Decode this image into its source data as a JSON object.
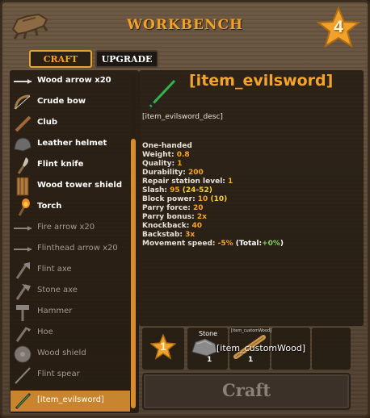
{
  "header": {
    "title": "WORKBENCH",
    "station_level": "4",
    "logo_icon": "workbench-icon"
  },
  "tabs": [
    {
      "label": "CRAFT",
      "active": true
    },
    {
      "label": "UPGRADE",
      "active": false
    }
  ],
  "recipes": [
    {
      "name": "Wood arrow x20",
      "icon": "wood-arrow-icon",
      "state": "available"
    },
    {
      "name": "Crude bow",
      "icon": "crude-bow-icon",
      "state": "available"
    },
    {
      "name": "Club",
      "icon": "club-icon",
      "state": "available"
    },
    {
      "name": "Leather helmet",
      "icon": "leather-helmet-icon",
      "state": "available"
    },
    {
      "name": "Flint knife",
      "icon": "flint-knife-icon",
      "state": "available"
    },
    {
      "name": "Wood tower shield",
      "icon": "wood-tower-shield-icon",
      "state": "available"
    },
    {
      "name": "Torch",
      "icon": "torch-icon",
      "state": "available"
    },
    {
      "name": "Fire arrow x20",
      "icon": "fire-arrow-icon",
      "state": "disabled"
    },
    {
      "name": "Flinthead arrow x20",
      "icon": "flinthead-arrow-icon",
      "state": "disabled"
    },
    {
      "name": "Flint axe",
      "icon": "flint-axe-icon",
      "state": "disabled"
    },
    {
      "name": "Stone axe",
      "icon": "stone-axe-icon",
      "state": "disabled"
    },
    {
      "name": "Hammer",
      "icon": "hammer-icon",
      "state": "disabled"
    },
    {
      "name": "Hoe",
      "icon": "hoe-icon",
      "state": "disabled"
    },
    {
      "name": "Wood shield",
      "icon": "wood-shield-icon",
      "state": "disabled"
    },
    {
      "name": "Flint spear",
      "icon": "flint-spear-icon",
      "state": "disabled"
    },
    {
      "name": "[item_evilsword]",
      "icon": "evil-sword-icon",
      "state": "selected"
    }
  ],
  "detail": {
    "name": "[item_evilsword]",
    "description": "[item_evilsword_desc]",
    "stats": [
      {
        "label": "One-handed",
        "value": "",
        "extra": ""
      },
      {
        "label": "Weight: ",
        "value": "0.8",
        "extra": ""
      },
      {
        "label": "Quality: ",
        "value": "1",
        "extra": ""
      },
      {
        "label": "Durability: ",
        "value": "200",
        "extra": ""
      },
      {
        "label": "Repair station level: ",
        "value": "1",
        "extra": ""
      },
      {
        "label": "Slash: ",
        "value": "95",
        "extra": " (24-52)"
      },
      {
        "label": "Block power: ",
        "value": "10",
        "extra": " (10)"
      },
      {
        "label": "Parry force: ",
        "value": "20",
        "extra": ""
      },
      {
        "label": "Parry bonus: ",
        "value": "2x",
        "extra": ""
      },
      {
        "label": "Knockback: ",
        "value": "40",
        "extra": ""
      },
      {
        "label": "Backstab: ",
        "value": "3x",
        "extra": ""
      },
      {
        "label": "Movement speed: ",
        "value": "-5%",
        "extra": "(Total:+0%)"
      }
    ]
  },
  "requirements": {
    "station_level": "1",
    "resources": [
      {
        "label": "Stone",
        "count": "1",
        "icon": "stone-icon"
      },
      {
        "label": "[item_customWood]",
        "count": "1",
        "icon": "custom-wood-icon"
      }
    ],
    "tooltip": "[item_customWood]"
  },
  "craft_button": {
    "label": "Craft",
    "enabled": false
  },
  "colors": {
    "accent": "#f0a22c",
    "selected_row": "#c8852e",
    "stat_value": "#f5a623"
  }
}
